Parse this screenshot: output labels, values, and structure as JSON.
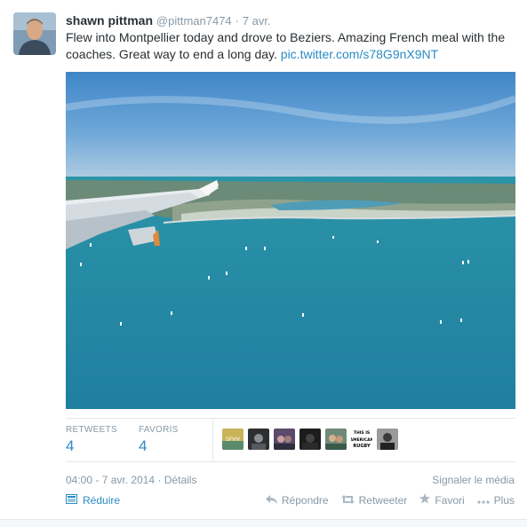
{
  "tweet": {
    "fullname": "shawn pittman",
    "username": "@pittman7474",
    "separator": "·",
    "time": "7 avr.",
    "text": "Flew into Montpellier today and drove to Beziers. Amazing French meal with the coaches. Great way to end a long day. ",
    "link": "pic.twitter.com/s78G9nX9NT"
  },
  "stats": {
    "retweets_label": "RETWEETS",
    "retweets_count": "4",
    "favorites_label": "FAVORIS",
    "favorites_count": "4",
    "favoriter_avatars": [
      "SFHV",
      "",
      "",
      "",
      "",
      "THIS IS AMERICAN RUGBY",
      ""
    ]
  },
  "meta": {
    "timestamp": "04:00 - 7 avr. 2014",
    "separator": "·",
    "details": "Détails",
    "report": "Signaler le média"
  },
  "controls": {
    "collapse": "Réduire",
    "reply": "Répondre",
    "retweet": "Retweeter",
    "favorite": "Favori",
    "more": "Plus"
  },
  "colors": {
    "link": "#2a8cc4",
    "muted": "#8899a6",
    "text": "#292f33"
  }
}
